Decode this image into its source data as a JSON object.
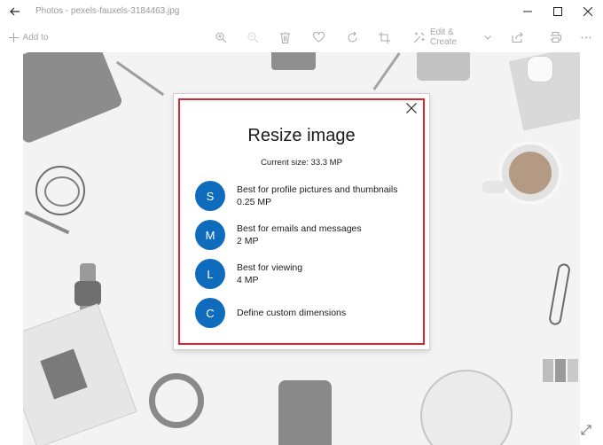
{
  "window": {
    "title": "Photos - pexels-fauxels-3184463.jpg"
  },
  "toolbar": {
    "add_to_label": "Add to",
    "edit_create_label": "Edit & Create"
  },
  "dialog": {
    "title": "Resize image",
    "current_size": "Current size: 33.3 MP",
    "options": [
      {
        "letter": "S",
        "label": "Best for profile pictures and thumbnails",
        "detail": "0.25 MP"
      },
      {
        "letter": "M",
        "label": "Best for emails and messages",
        "detail": "2 MP"
      },
      {
        "letter": "L",
        "label": "Best for viewing",
        "detail": "4 MP"
      },
      {
        "letter": "C",
        "label": "Define custom dimensions",
        "detail": ""
      }
    ]
  },
  "colors": {
    "accent": "#0f6cbd",
    "highlight_border": "#d9262b"
  }
}
